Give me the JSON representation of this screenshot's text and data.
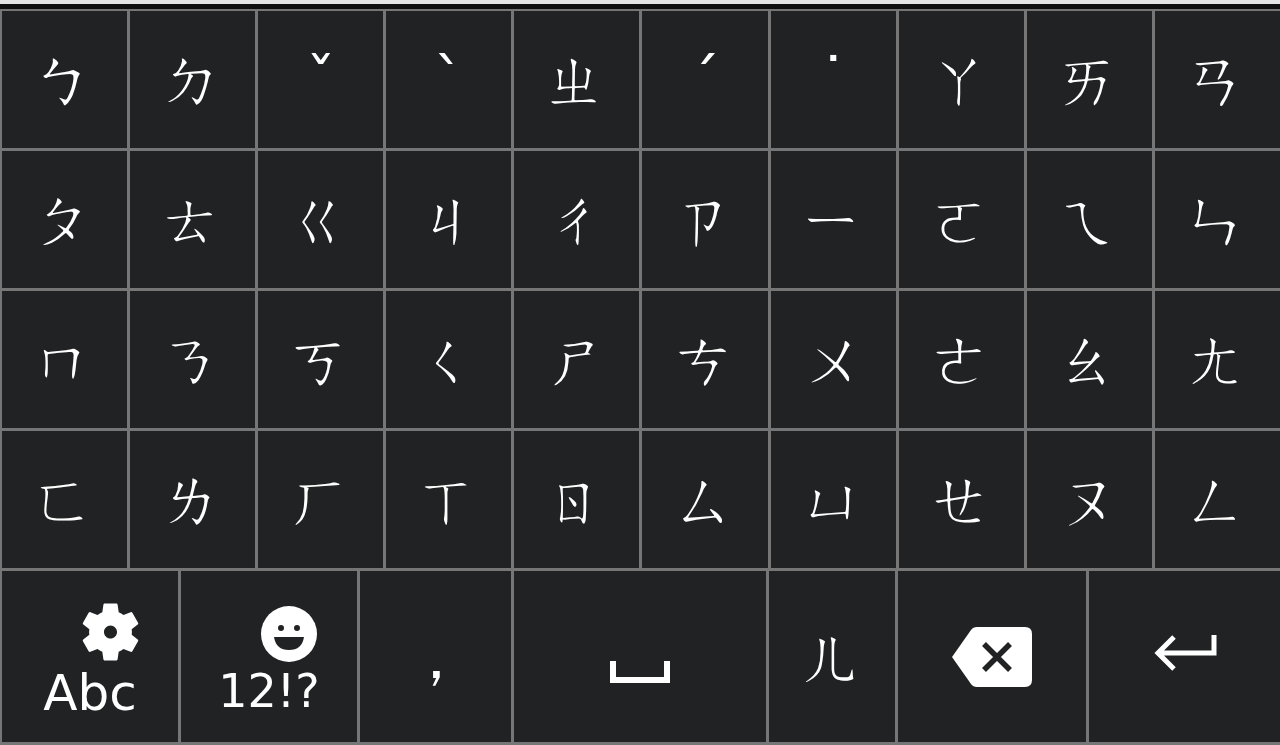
{
  "keyboard": {
    "rows": [
      [
        "ㄅ",
        "ㄉ",
        "ˇ",
        "ˋ",
        "ㄓ",
        "ˊ",
        "˙",
        "ㄚ",
        "ㄞ",
        "ㄢ"
      ],
      [
        "ㄆ",
        "ㄊ",
        "ㄍ",
        "ㄐ",
        "ㄔ",
        "ㄗ",
        "ㄧ",
        "ㄛ",
        "ㄟ",
        "ㄣ"
      ],
      [
        "ㄇ",
        "ㄋ",
        "ㄎ",
        "ㄑ",
        "ㄕ",
        "ㄘ",
        "ㄨ",
        "ㄜ",
        "ㄠ",
        "ㄤ"
      ],
      [
        "ㄈ",
        "ㄌ",
        "ㄏ",
        "ㄒ",
        "ㄖ",
        "ㄙ",
        "ㄩ",
        "ㄝ",
        "ㄡ",
        "ㄥ"
      ]
    ],
    "bottom_row": [
      {
        "kind": "settings",
        "label": "Abc"
      },
      {
        "kind": "emoji",
        "label": "12!?"
      },
      {
        "kind": "char",
        "label": "，"
      },
      {
        "kind": "space"
      },
      {
        "kind": "char",
        "label": "ㄦ"
      },
      {
        "kind": "backspace"
      },
      {
        "kind": "enter"
      }
    ]
  }
}
